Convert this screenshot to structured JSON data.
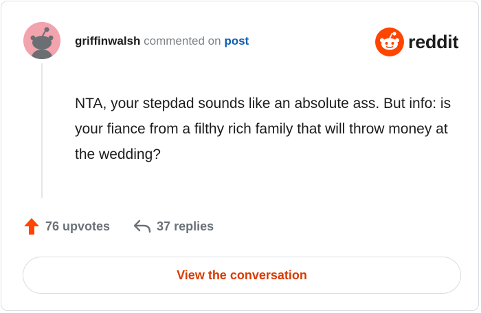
{
  "comment": {
    "username": "griffinwalsh",
    "action_text": "commented on",
    "post_link": "post",
    "body": "NTA, your stepdad sounds like an absolute ass. But info: is your fiance from a filthy rich family that will throw money at the wedding?"
  },
  "brand": {
    "logo_text": "reddit",
    "logo_icon": "reddit-snoo-icon",
    "accent_color": "#ff4500"
  },
  "stats": {
    "upvotes_label": "76 upvotes",
    "upvote_icon": "upvote-arrow-icon",
    "replies_label": "37 replies",
    "reply_icon": "reply-arrow-icon"
  },
  "cta": {
    "label": "View the conversation"
  }
}
